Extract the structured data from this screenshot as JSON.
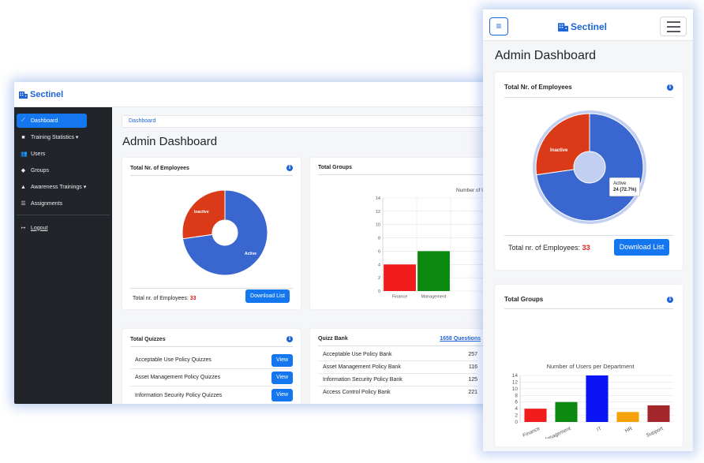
{
  "brand": "Sectinel",
  "desktop": {
    "sidebar": [
      {
        "label": "Dashboard",
        "icon": "chart-icon"
      },
      {
        "label": "Training Statistics ▾",
        "icon": "square-icon"
      },
      {
        "label": "Users",
        "icon": "users-icon"
      },
      {
        "label": "Groups",
        "icon": "layers-icon"
      },
      {
        "label": "Awareness Trainings ▾",
        "icon": "teacher-icon"
      },
      {
        "label": "Assignments",
        "icon": "list-icon"
      }
    ],
    "logout": "Logout",
    "breadcrumb": "Dashboard",
    "page_title": "Admin Dashboard",
    "employees": {
      "title": "Total Nr. of Employees",
      "label_inactive": "Inactive",
      "label_active": "Active",
      "footer_label": "Total nr. of Employees:",
      "count": "33",
      "button": "Download List"
    },
    "groups": {
      "title": "Total Groups",
      "chart_title": "Number of U"
    },
    "quizzes": {
      "title": "Total Quizzes",
      "rows": [
        {
          "name": "Acceptable Use Policy Quizzes",
          "action": "View"
        },
        {
          "name": "Asset Management Policy Quizzes",
          "action": "View"
        },
        {
          "name": "Information Security Policy Quizzes",
          "action": "View"
        }
      ]
    },
    "quiz_bank": {
      "title": "Quizz Bank",
      "link": "1658 Questions",
      "rows": [
        {
          "name": "Acceptable Use Policy Bank",
          "count": "257"
        },
        {
          "name": "Asset Management Policy Bank",
          "count": "116"
        },
        {
          "name": "Information Security Policy Bank",
          "count": "125"
        },
        {
          "name": "Access Control Policy Bank",
          "count": "221"
        }
      ]
    }
  },
  "mobile": {
    "page_title": "Admin Dashboard",
    "employees": {
      "title": "Total Nr. of Employees",
      "label_inactive": "Inactive",
      "tooltip_title": "Active",
      "tooltip_value": "24 (72.7%)",
      "footer_label": "Total nr. of Employees:",
      "count": "33",
      "button": "Download List"
    },
    "groups": {
      "title": "Total Groups"
    }
  },
  "colors": {
    "primary": "#1577ef",
    "brand": "#1f64d6",
    "sidebar": "#212529",
    "active": "#3a66d0",
    "inactive": "#db3a19"
  },
  "chart_data": [
    {
      "type": "pie",
      "title": "Total Nr. of Employees",
      "categories": [
        "Active",
        "Inactive"
      ],
      "values": [
        24,
        9
      ],
      "colors": [
        "#3a66d0",
        "#db3a19"
      ]
    },
    {
      "type": "bar",
      "title": "Number of Users per Department",
      "categories": [
        "Finance",
        "Management",
        "IT",
        "HR",
        "Support"
      ],
      "values": [
        4,
        6,
        14,
        3,
        5
      ],
      "colors": [
        "#f21c1c",
        "#0c8a10",
        "#0a14f5",
        "#f3a209",
        "#a3262a"
      ],
      "yticks": [
        "0",
        "2",
        "4",
        "6",
        "8",
        "10",
        "12",
        "14"
      ],
      "ylim": [
        0,
        14
      ]
    }
  ]
}
